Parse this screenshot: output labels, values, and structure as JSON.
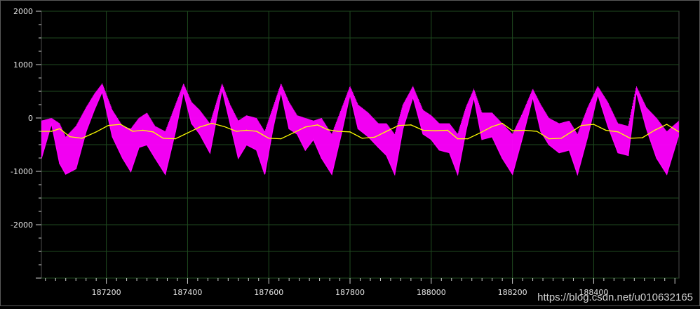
{
  "chart_data": {
    "type": "line",
    "title": "",
    "xlabel": "",
    "ylabel": "",
    "xlim": [
      187040,
      188610
    ],
    "ylim": [
      -3000,
      2000
    ],
    "x_ticks": [
      187200,
      187400,
      187600,
      187800,
      188000,
      188200,
      188400
    ],
    "x_tick_labels": [
      "187200",
      "187400",
      "187600",
      "187800",
      "188000",
      "188200",
      "188400"
    ],
    "y_ticks": [
      2000,
      1000,
      0,
      -1000,
      -2000
    ],
    "y_tick_labels": [
      "2000",
      "1000",
      "0",
      "-1000",
      "-2000"
    ],
    "grid": true,
    "background": "#000000",
    "grid_color": "#1f4a1f",
    "series": [
      {
        "color": "#ff00ff",
        "style": "noisy-oscillation",
        "x": [
          187040,
          187065,
          187085,
          187100,
          187125,
          187150,
          187170,
          187190,
          187215,
          187240,
          187260,
          187280,
          187300,
          187320,
          187345,
          187370,
          187390,
          187410,
          187430,
          187455,
          187485,
          187505,
          187525,
          187545,
          187570,
          187590,
          187610,
          187630,
          187650,
          187670,
          187690,
          187710,
          187730,
          187755,
          187780,
          187800,
          187820,
          187845,
          187870,
          187890,
          187910,
          187930,
          187955,
          187980,
          188000,
          188020,
          188045,
          188065,
          188085,
          188105,
          188125,
          188150,
          188175,
          188200,
          188225,
          188250,
          188270,
          188290,
          188315,
          188340,
          188360,
          188385,
          188410,
          188435,
          188460,
          188485,
          188505,
          188530,
          188555,
          188580,
          188610
        ],
        "y": [
          -750,
          -100,
          -850,
          -1050,
          -950,
          -250,
          150,
          500,
          -350,
          -750,
          -1000,
          -550,
          -500,
          -750,
          -1050,
          -250,
          500,
          -100,
          -300,
          -650,
          550,
          -100,
          -750,
          -500,
          -600,
          -1050,
          -200,
          500,
          -200,
          -300,
          -600,
          -400,
          -750,
          -1050,
          -250,
          450,
          -200,
          -350,
          -550,
          -700,
          -1050,
          -200,
          400,
          -300,
          -400,
          -600,
          -650,
          -1050,
          -250,
          400,
          -400,
          -350,
          -750,
          -1050,
          -350,
          400,
          -250,
          -500,
          -650,
          -600,
          -1050,
          -350,
          450,
          -150,
          -650,
          -700,
          500,
          -200,
          -750,
          -1050,
          -300
        ],
        "upper": [
          -50,
          0,
          -100,
          -350,
          -150,
          200,
          450,
          650,
          150,
          -150,
          -200,
          0,
          100,
          -150,
          -250,
          250,
          650,
          300,
          150,
          -100,
          650,
          250,
          -50,
          50,
          0,
          -250,
          200,
          650,
          300,
          50,
          0,
          -50,
          0,
          -300,
          200,
          600,
          250,
          100,
          -100,
          -100,
          -300,
          250,
          600,
          150,
          50,
          -100,
          -100,
          -300,
          200,
          550,
          100,
          100,
          -100,
          -300,
          100,
          550,
          250,
          0,
          -100,
          -50,
          -300,
          200,
          600,
          300,
          -100,
          -150,
          600,
          200,
          0,
          -250,
          -50
        ]
      },
      {
        "color": "#ffff00",
        "style": "smooth",
        "x": [
          187040,
          187065,
          187085,
          187110,
          187140,
          187175,
          187205,
          187235,
          187265,
          187290,
          187315,
          187340,
          187370,
          187400,
          187430,
          187460,
          187490,
          187520,
          187545,
          187570,
          187600,
          187630,
          187660,
          187690,
          187720,
          187745,
          187770,
          187800,
          187830,
          187860,
          187890,
          187920,
          187950,
          187980,
          188010,
          188040,
          188065,
          188090,
          188120,
          188150,
          188175,
          188200,
          188230,
          188260,
          188290,
          188320,
          188345,
          188370,
          188400,
          188430,
          188460,
          188490,
          188520,
          188550,
          188580,
          188610
        ],
        "y": [
          -250,
          -250,
          -200,
          -350,
          -380,
          -260,
          -140,
          -120,
          -250,
          -230,
          -260,
          -380,
          -390,
          -280,
          -170,
          -100,
          -160,
          -250,
          -230,
          -250,
          -380,
          -390,
          -280,
          -170,
          -130,
          -220,
          -250,
          -260,
          -380,
          -360,
          -250,
          -140,
          -130,
          -230,
          -240,
          -230,
          -390,
          -390,
          -280,
          -160,
          -100,
          -240,
          -230,
          -250,
          -390,
          -380,
          -260,
          -140,
          -120,
          -230,
          -260,
          -380,
          -370,
          -230,
          -120,
          -260
        ]
      }
    ]
  },
  "watermark": "https://blog.csdn.net/u010632165"
}
